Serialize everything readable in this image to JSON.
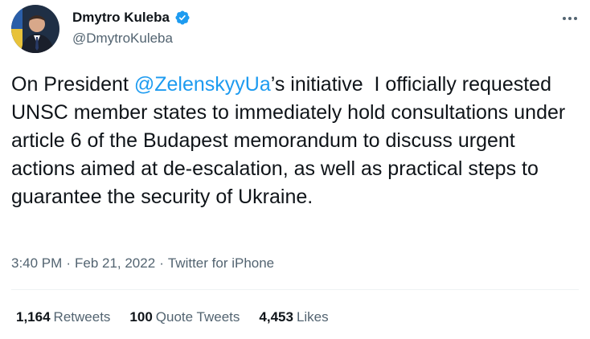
{
  "author": {
    "name": "Dmytro Kuleba",
    "handle": "@DmytroKuleba"
  },
  "tweet": {
    "text_before": "On President ",
    "mention": "@ZelenskyyUa",
    "text_after": "’s initiative  I officially requested UNSC member states to immediately hold consultations under article 6 of the Budapest memorandum to discuss urgent actions aimed at de-escalation, as well as practical steps to guarantee the security of Ukraine."
  },
  "meta": {
    "time": "3:40 PM",
    "separator": "·",
    "date": "Feb 21, 2022",
    "source": "Twitter for iPhone"
  },
  "stats": {
    "retweets_count": "1,164",
    "retweets_label": "Retweets",
    "quotes_count": "100",
    "quotes_label": "Quote Tweets",
    "likes_count": "4,453",
    "likes_label": "Likes"
  },
  "colors": {
    "accent": "#1d9bf0",
    "text": "#0f1419",
    "secondary": "#536471"
  },
  "icons": {
    "verified": "verified-badge-icon",
    "more": "more-horizontal-icon"
  }
}
